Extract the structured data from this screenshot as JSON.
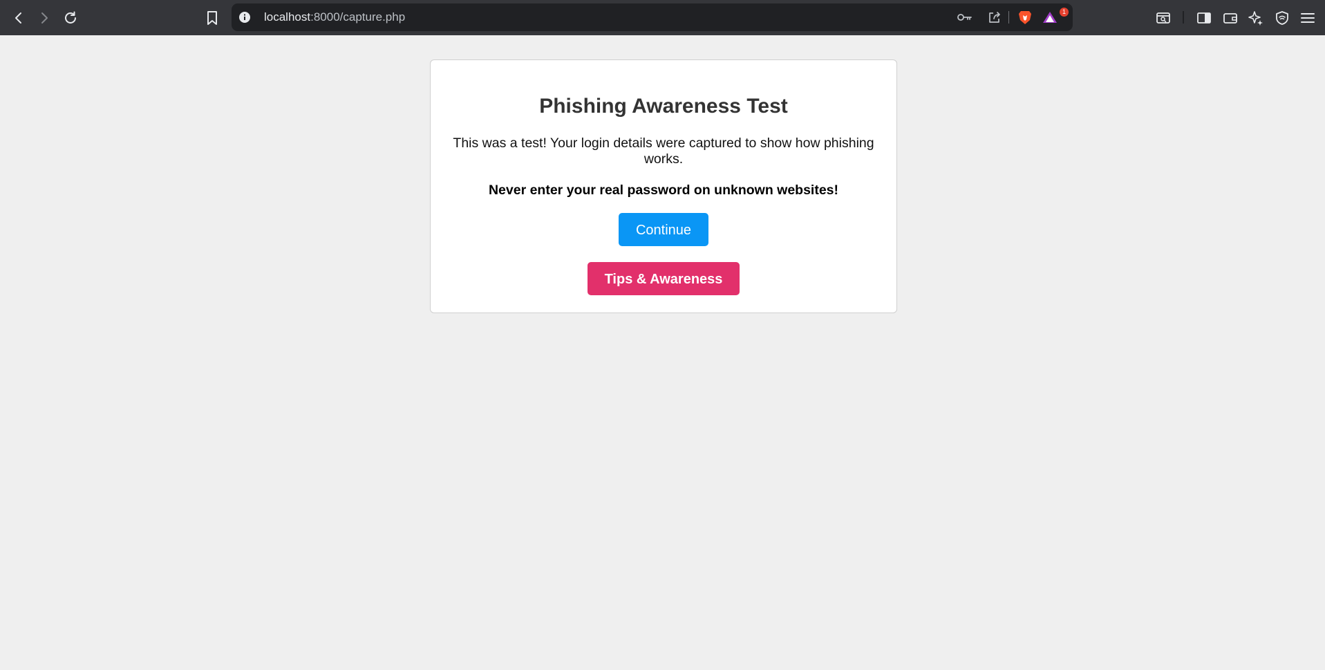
{
  "browser": {
    "url_host": "localhost",
    "url_path": ":8000/capture.php",
    "notification_count": "1",
    "colors": {
      "toolbar_bg": "#35363a",
      "address_bar_bg": "#202124",
      "brave_orange": "#fb542b",
      "badge_red": "#e5412f"
    },
    "icons": {
      "back": "back-arrow-icon",
      "forward": "forward-arrow-icon",
      "reload": "reload-icon",
      "bookmark": "bookmark-icon",
      "info": "site-info-icon",
      "key": "password-key-icon",
      "share": "share-icon",
      "brave": "brave-shields-icon",
      "rewards": "brave-rewards-icon",
      "search_tab": "tab-search-icon",
      "sidebar": "sidebar-icon",
      "wallet": "wallet-icon",
      "leo": "leo-ai-icon",
      "vpn": "vpn-shield-icon",
      "menu": "hamburger-menu-icon"
    }
  },
  "page": {
    "title": "Phishing Awareness Test",
    "message": "This was a test! Your login details were captured to show how phishing works.",
    "warning": "Never enter your real password on unknown websites!",
    "continue_label": "Continue",
    "tips_label": "Tips & Awareness",
    "colors": {
      "background": "#efefef",
      "card": "#ffffff",
      "continue_button": "#0a96f5",
      "tips_button": "#e2306b",
      "title_text": "#333333"
    }
  }
}
